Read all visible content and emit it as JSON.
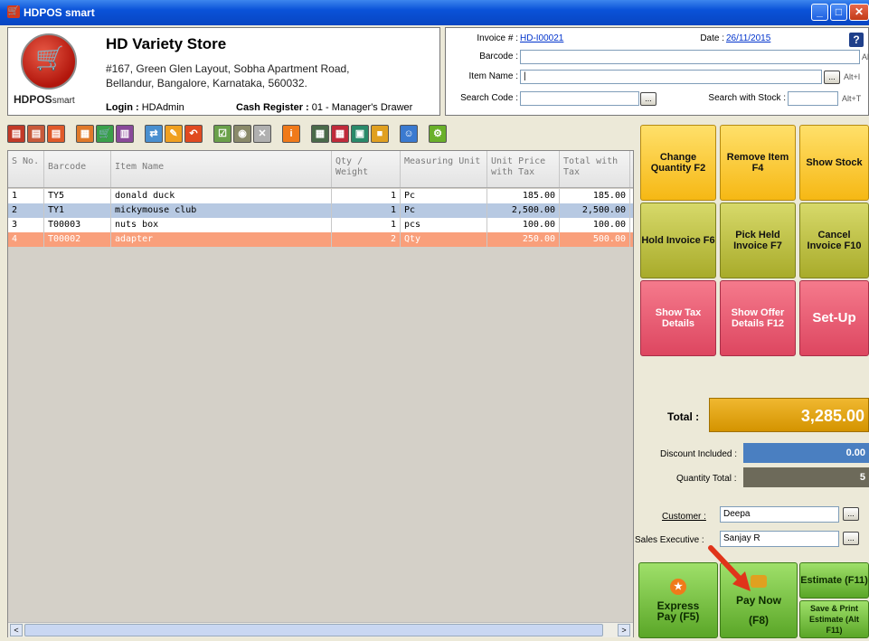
{
  "window": {
    "title": "HDPOS smart"
  },
  "header": {
    "store_name": "HD Variety Store",
    "address_line1": "#167, Green Glen Layout, Sobha Apartment Road,",
    "address_line2": "Bellandur, Bangalore, Karnataka, 560032.",
    "brand": "HDPOS",
    "brand_suffix": "smart",
    "login_label": "Login :",
    "login_value": "HDAdmin",
    "cash_register_label": "Cash Register :",
    "cash_register_value": "01 - Manager's Drawer"
  },
  "invoice": {
    "invoice_label": "Invoice # :",
    "invoice_number": "HD-I00021",
    "date_label": "Date :",
    "date_value": "26/11/2015",
    "barcode_label": "Barcode :",
    "item_name_label": "Item Name :",
    "search_code_label": "Search Code :",
    "search_stock_label": "Search with Stock :",
    "alt_barcode": "Alt+B",
    "alt_item": "Alt+I",
    "alt_stock": "Alt+T",
    "dots": "...",
    "help": "?"
  },
  "grid": {
    "columns": [
      {
        "label": "S No."
      },
      {
        "label": "Barcode"
      },
      {
        "label": "Item Name"
      },
      {
        "label": "Qty / Weight"
      },
      {
        "label": "Measuring Unit"
      },
      {
        "label": "Unit Price with Tax"
      },
      {
        "label": "Total with Tax"
      }
    ],
    "rows": [
      {
        "sno": "1",
        "barcode": "TY5",
        "item": "donald duck",
        "qty": "1",
        "unit": "Pc",
        "price": "185.00",
        "total": "185.00",
        "state": "normal"
      },
      {
        "sno": "2",
        "barcode": "TY1",
        "item": "mickymouse club",
        "qty": "1",
        "unit": "Pc",
        "price": "2,500.00",
        "total": "2,500.00",
        "state": "hover"
      },
      {
        "sno": "3",
        "barcode": "T00003",
        "item": "nuts box",
        "qty": "1",
        "unit": "pcs",
        "price": "100.00",
        "total": "100.00",
        "state": "normal"
      },
      {
        "sno": "4",
        "barcode": "T00002",
        "item": "adapter",
        "qty": "2",
        "unit": "Qty",
        "price": "250.00",
        "total": "500.00",
        "state": "selected"
      }
    ]
  },
  "actions": {
    "change_quantity": "Change Quantity F2",
    "remove_item": "Remove Item F4",
    "show_stock": "Show Stock",
    "hold_invoice": "Hold Invoice F6",
    "pick_held_invoice": "Pick Held Invoice F7",
    "cancel_invoice": "Cancel Invoice F10",
    "show_tax_details": "Show Tax Details",
    "show_offer_details": "Show Offer Details F12",
    "setup": "Set-Up",
    "express_pay": "Express Pay (F5)",
    "pay_now": "Pay Now",
    "pay_now_key": "(F8)",
    "estimate": "Estimate (F11)",
    "save_print_estimate": "Save & Print Estimate (Alt F11)"
  },
  "totals": {
    "total_label": "Total :",
    "total_value": "3,285.00",
    "discount_label": "Discount Included :",
    "discount_value": "0.00",
    "quantity_label": "Quantity Total :",
    "quantity_value": "5",
    "customer_label": "Customer :",
    "customer_value": "Deepa",
    "sales_exec_label": "Sales Executive :",
    "sales_exec_value": "Sanjay R"
  },
  "colors": {
    "selected_row": "#f99f7b",
    "hover_row": "#b7c9e2",
    "total_bar": "#e3a300",
    "discount_bar": "#4a7fc1",
    "quantity_bar": "#6d6a5a"
  }
}
